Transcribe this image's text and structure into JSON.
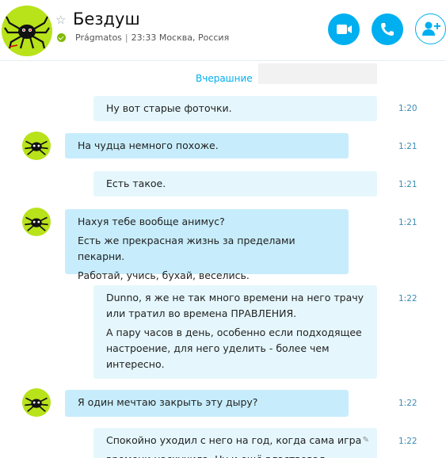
{
  "header": {
    "name": "Бездуш",
    "mood": "Prágmatos",
    "local_time": "23:33 Москва, Россия",
    "separator": "|"
  },
  "conversation": {
    "date_divider": "Вчерашние",
    "messages": [
      {
        "direction": "out",
        "lines": [
          "Ну вот старые фоточки."
        ],
        "time": "1:20"
      },
      {
        "direction": "in",
        "lines": [
          "На чудца немного похоже."
        ],
        "time": "1:21"
      },
      {
        "direction": "out",
        "lines": [
          "Есть такое."
        ],
        "time": "1:21"
      },
      {
        "direction": "in",
        "lines": [
          "Нахуя тебе вообще анимус?",
          "Есть же прекрасная жизнь за пределами пекарни.",
          "Работай, учись, бухай, веселись."
        ],
        "time": "1:21"
      },
      {
        "direction": "out",
        "lines": [
          "Dunno, я же не так много времени на него трачу или тратил во времена ПРАВЛЕНИЯ.",
          "А пару часов в день, особенно если подходящее настроение, для него уделить - более чем интересно."
        ],
        "time": "1:22"
      },
      {
        "direction": "in",
        "lines": [
          "Я один мечтаю закрыть эту дыру?"
        ],
        "time": "1:22"
      },
      {
        "direction": "out",
        "lines": [
          "Спокойно уходил с него на год, когда сама игра",
          "времени наскучила. Ну и ещё властвовал"
        ],
        "time": "1:22",
        "edited": true
      }
    ]
  },
  "colors": {
    "accent": "#00aff0",
    "avatar_bg": "#b8e21a",
    "status": "#7fba00"
  },
  "icons": [
    "star-icon",
    "status-online-icon",
    "video-call-icon",
    "audio-call-icon",
    "add-people-icon",
    "edited-pencil-icon"
  ]
}
